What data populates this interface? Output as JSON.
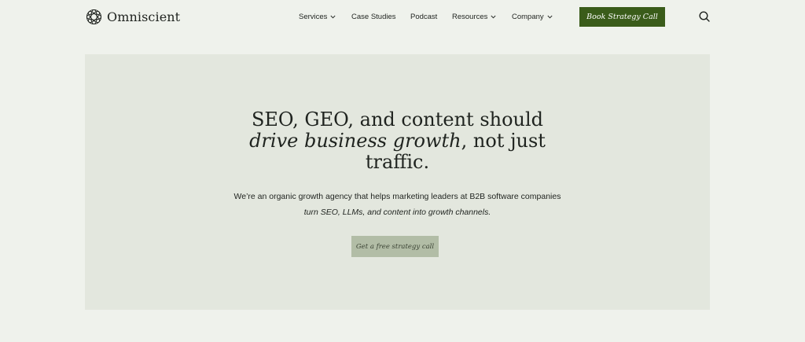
{
  "brand": {
    "name": "Omniscient",
    "logo_icon": "geometric-rosette-logo"
  },
  "nav": {
    "items": [
      {
        "label": "Services",
        "has_dropdown": true
      },
      {
        "label": "Case Studies",
        "has_dropdown": false
      },
      {
        "label": "Podcast",
        "has_dropdown": false
      },
      {
        "label": "Resources",
        "has_dropdown": true
      },
      {
        "label": "Company",
        "has_dropdown": true
      }
    ],
    "cta_label": "Book Strategy Call",
    "search_icon": "search-icon"
  },
  "hero": {
    "headline_line1": "SEO, GEO, and content should",
    "headline_italic": "drive business growth",
    "headline_rest": ", not just",
    "headline_line3": "traffic.",
    "sub_line1": "We’re an organic growth agency that helps marketing leaders at B2B software companies",
    "sub_line2": "turn SEO, LLMs, and content into growth channels.",
    "button_label": "Get a free strategy call"
  },
  "colors": {
    "page_bg": "#eff2ec",
    "hero_bg": "#e3e7de",
    "cta_bg": "#3a5c1a",
    "hero_button_bg": "#b2bda6",
    "text": "#1f231f"
  }
}
